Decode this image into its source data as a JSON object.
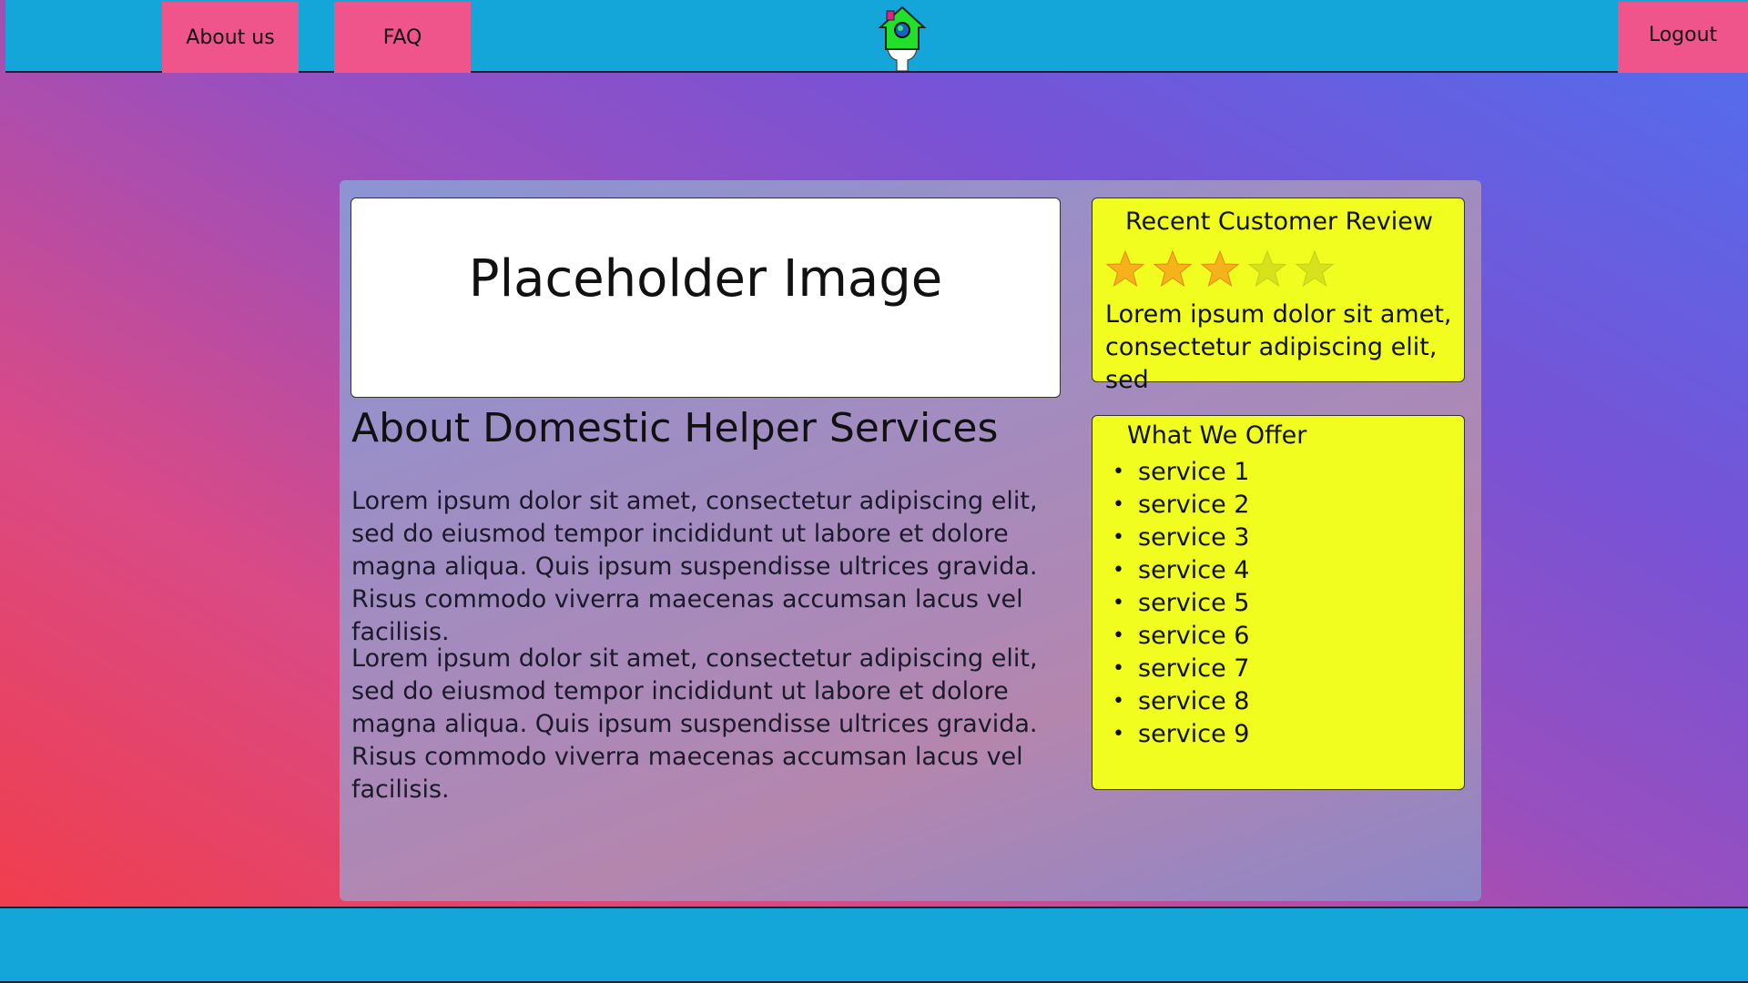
{
  "nav": {
    "about_label": "About us",
    "faq_label": "FAQ",
    "logout_label": "Logout",
    "logo_icon": "house-hand-logo-icon"
  },
  "main": {
    "placeholder_label": "Placeholder Image",
    "title": "About Domestic Helper Services",
    "paragraphs": [
      "Lorem ipsum dolor sit amet, consectetur adipiscing elit, sed do eiusmod tempor incididunt ut labore et dolore magna aliqua. Quis ipsum suspendisse ultrices gravida. Risus commodo viverra maecenas accumsan lacus vel facilisis.",
      "Lorem ipsum dolor sit amet, consectetur adipiscing elit, sed do eiusmod tempor incididunt ut labore et dolore magna aliqua. Quis ipsum suspendisse ultrices gravida. Risus commodo viverra maecenas accumsan lacus vel facilisis."
    ]
  },
  "review": {
    "title": "Recent Customer Review",
    "rating": 3,
    "max_rating": 5,
    "text": "Lorem ipsum dolor sit amet, consectetur adipiscing elit, sed"
  },
  "offer": {
    "title": "What We Offer",
    "bullet": "•",
    "services": [
      "service 1",
      "service 2",
      "service 3",
      "service 4",
      "service 5",
      "service 6",
      "service 7",
      "service 8",
      "service 9"
    ]
  },
  "colors": {
    "nav_bg": "#14a5d9",
    "nav_button": "#ef548b",
    "card_bg": "#f0fd1e",
    "star_filled": "#f6b21b",
    "star_empty": "#d5e21c"
  }
}
